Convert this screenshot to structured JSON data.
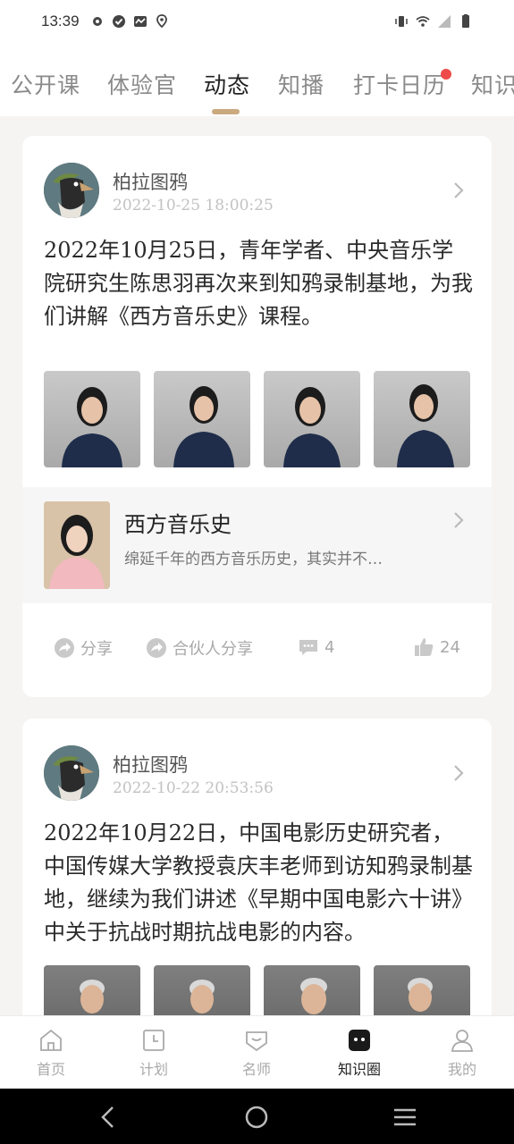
{
  "status_bar": {
    "time": "13:39"
  },
  "top_tabs": [
    "公开课",
    "体验官",
    "动态",
    "知播",
    "打卡日历",
    "知识"
  ],
  "active_tab_index": 2,
  "posts": [
    {
      "author": "柏拉图鸦",
      "timestamp": "2022-10-25 18:00:25",
      "text": "2022年10月25日，青年学者、中央音乐学院研究生陈思羽再次来到知鸦录制基地，为我们讲解《西方音乐史》课程。",
      "photo_count": 4,
      "course": {
        "title": "西方音乐史",
        "description": "绵延千年的西方音乐历史，其实并不…"
      },
      "actions": {
        "share": "分享",
        "partner_share": "合伙人分享",
        "comments": "4",
        "likes": "24"
      }
    },
    {
      "author": "柏拉图鸦",
      "timestamp": "2022-10-22 20:53:56",
      "text": "2022年10月22日，中国电影历史研究者，中国传媒大学教授袁庆丰老师到访知鸦录制基地，继续为我们讲述《早期中国电影六十讲》中关于抗战时期抗战电影的内容。",
      "photo_count": 4
    }
  ],
  "bottom_nav": [
    {
      "label": "首页",
      "icon": "home-icon"
    },
    {
      "label": "计划",
      "icon": "calendar-icon"
    },
    {
      "label": "名师",
      "icon": "teacher-icon"
    },
    {
      "label": "知识圈",
      "icon": "chat-icon"
    },
    {
      "label": "我的",
      "icon": "profile-icon"
    }
  ],
  "active_nav_index": 3,
  "colors": {
    "accent": "#caa97f",
    "badge": "#ee4a4a"
  }
}
